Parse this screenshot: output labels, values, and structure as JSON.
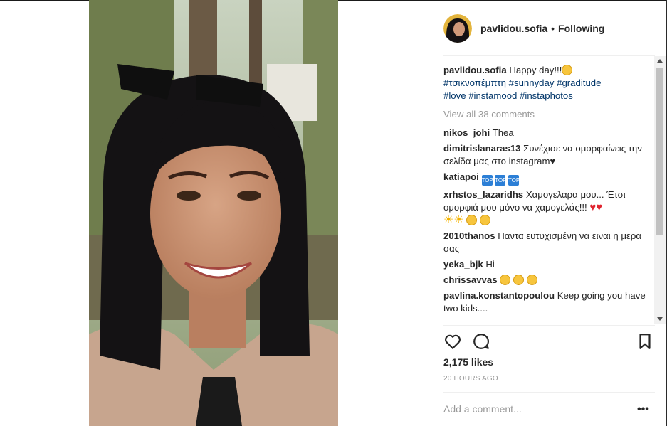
{
  "post": {
    "username": "pavlidou.sofia",
    "separator": "•",
    "follow_status": "Following",
    "caption": {
      "username": "pavlidou.sofia",
      "text": "Happy day!!!",
      "hashtags_line1": [
        "#τσικνοπέμπτη",
        "#sunnyday",
        "#graditude"
      ],
      "hashtags_line2": [
        "#love",
        "#instamood",
        "#instaphotos"
      ]
    },
    "view_all": "View all 38 comments",
    "comments": [
      {
        "user": "nikos_johi",
        "text": "Thea"
      },
      {
        "user": "dimitrislanaras13",
        "text": "Συνέχισε να ομορφαίνεις την σελίδα μας στο instagram♥"
      },
      {
        "user": "katiapoi",
        "text": ""
      },
      {
        "user": "xrhstos_lazaridhs",
        "text": "Χαμογελαρα μου... Έτσι ομορφιά μου μόνο να χαμογελάς!!!"
      },
      {
        "user": "2010thanos",
        "text": "Παντα ευτυχισμένη να ειναι η μερα σας"
      },
      {
        "user": "yeka_bjk",
        "text": "Hi"
      },
      {
        "user": "chrissavvas",
        "text": ""
      },
      {
        "user": "pavlina.konstantopoulou",
        "text": "Keep going you have two kids...."
      }
    ],
    "likes": "2,175 likes",
    "time_ago": "20 HOURS AGO",
    "add_comment_placeholder": "Add a comment...",
    "more_label": "•••",
    "top_badge": "TOP"
  },
  "icons": {
    "like": "heart-outline",
    "comment": "speech-bubble",
    "save": "bookmark-outline"
  }
}
